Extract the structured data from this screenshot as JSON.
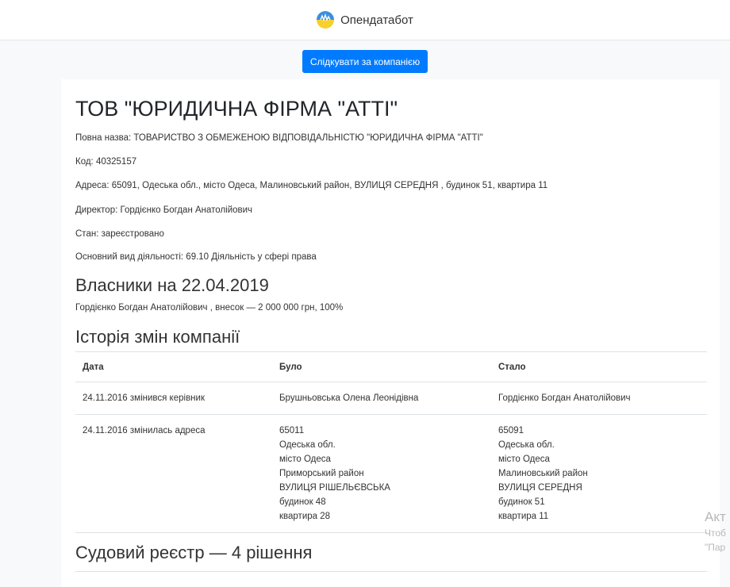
{
  "header": {
    "brand_name": "Опендатабот"
  },
  "follow_button": "Слідкувати за компанією",
  "company": {
    "title": "ТОВ \"ЮРИДИЧНА ФІРМА \"АТТІ\"",
    "full_name_label": "Повна назва:",
    "full_name": "ТОВАРИСТВО З ОБМЕЖЕНОЮ ВІДПОВІДАЛЬНІСТЮ \"ЮРИДИЧНА ФІРМА \"АТТІ\"",
    "code_label": "Код:",
    "code": "40325157",
    "address_label": "Адреса:",
    "address": "65091, Одеська обл., місто Одеса, Малиновський район, ВУЛИЦЯ СЕРЕДНЯ , будинок 51, квартира 11",
    "director_label": "Директор:",
    "director": "Гордієнко Богдан Анатолійович",
    "status_label": "Стан:",
    "status": "зареєстровано",
    "activity_label": "Основний вид діяльності:",
    "activity": "69.10 Діяльність у сфері права"
  },
  "owners": {
    "title": "Власники на 22.04.2019",
    "line": "Гордієнко Богдан Анатолійович , внесок — 2 000 000 грн, 100%"
  },
  "history": {
    "title": "Історія змін компанії",
    "columns": [
      "Дата",
      "Було",
      "Стало"
    ],
    "rows": [
      {
        "date": "24.11.2016 змінився керівник",
        "before": [
          "Брушньовська Олена Леонідівна"
        ],
        "after": [
          "Гордієнко Богдан Анатолійович"
        ]
      },
      {
        "date": "24.11.2016 змінилась адреса",
        "before": [
          "65011",
          "Одеська обл.",
          "місто Одеса",
          "Приморський район",
          "ВУЛИЦЯ РІШЕЛЬЄВСЬКА",
          "будинок 48",
          "квартира 28"
        ],
        "after": [
          "65091",
          "Одеська обл.",
          "місто Одеса",
          "Малиновський район",
          "ВУЛИЦЯ СЕРЕДНЯ",
          "будинок 51",
          "квартира 11"
        ]
      }
    ]
  },
  "court": {
    "title": "Судовий реєстр — 4 рішення"
  },
  "watermark": {
    "line1": "Акт",
    "line2": "Чтоб",
    "line3": "\"Пар"
  },
  "colors": {
    "accent": "#007bff",
    "logo_blue": "#3b8ede",
    "logo_yellow": "#f6d02f"
  }
}
